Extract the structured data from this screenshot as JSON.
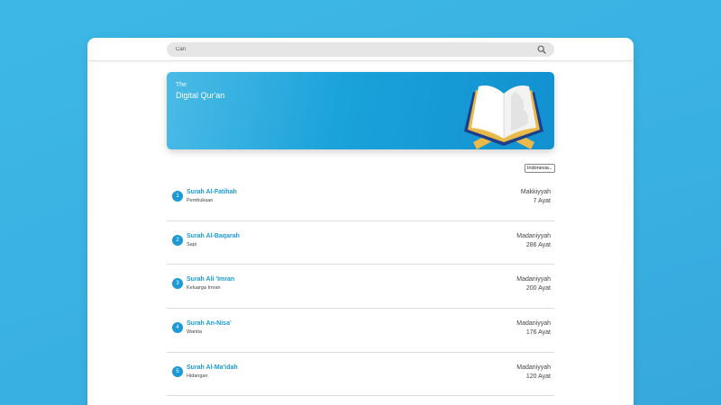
{
  "search": {
    "placeholder": "Cari"
  },
  "hero": {
    "small_text": "The",
    "title": "Digital Qur'an"
  },
  "language_select": {
    "selected": "Indonesia"
  },
  "surahs": [
    {
      "number": "1",
      "name": "Surah Al-Fatihah",
      "meaning": "Pembukaan",
      "place": "Makkiyyah",
      "ayat": "7 Ayat"
    },
    {
      "number": "2",
      "name": "Surah Al-Baqarah",
      "meaning": "Sapi",
      "place": "Madaniyyah",
      "ayat": "286 Ayat"
    },
    {
      "number": "3",
      "name": "Surah Ali 'Imran",
      "meaning": "Keluarga Imran",
      "place": "Madaniyyah",
      "ayat": "200 Ayat"
    },
    {
      "number": "4",
      "name": "Surah An-Nisa'",
      "meaning": "Wanita",
      "place": "Madaniyyah",
      "ayat": "176 Ayat"
    },
    {
      "number": "5",
      "name": "Surah Al-Ma'idah",
      "meaning": "Hidangan",
      "place": "Madaniyyah",
      "ayat": "120 Ayat"
    }
  ],
  "icons": {
    "search": "search-icon",
    "book": "open-quran-icon",
    "dropdown": "chevron-down-icon"
  },
  "colors": {
    "background": "#3db8e6",
    "accent": "#1b9ad6",
    "banner_start": "#4bbbe6",
    "banner_end": "#1291d0",
    "book_gold": "#e9b949",
    "book_navy": "#1f3f8a"
  }
}
